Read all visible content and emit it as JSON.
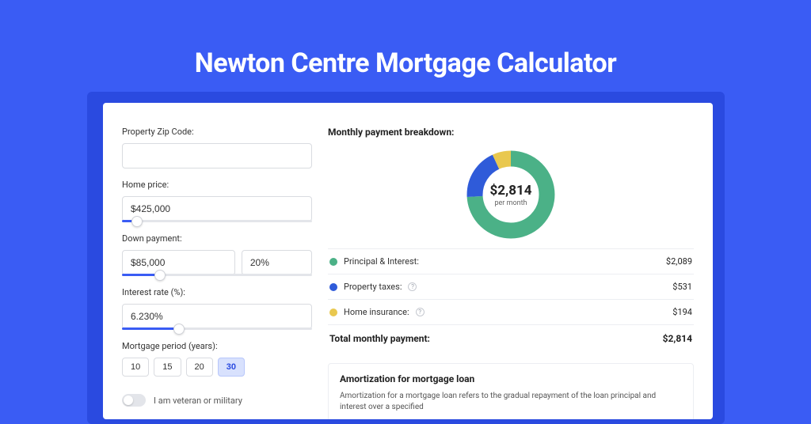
{
  "title": "Newton Centre Mortgage Calculator",
  "form": {
    "zip": {
      "label": "Property Zip Code:",
      "value": ""
    },
    "price": {
      "label": "Home price:",
      "value": "$425,000",
      "slider_pct": 8
    },
    "down": {
      "label": "Down payment:",
      "amount": "$85,000",
      "percent": "20%",
      "slider_pct": 20
    },
    "rate": {
      "label": "Interest rate (%):",
      "value": "6.230%",
      "slider_pct": 30
    },
    "period": {
      "label": "Mortgage period (years):",
      "options": [
        "10",
        "15",
        "20",
        "30"
      ],
      "selected": "30"
    },
    "veteran": {
      "label": "I am veteran or military",
      "value": false
    }
  },
  "breakdown": {
    "heading": "Monthly payment breakdown:",
    "center_amount": "$2,814",
    "center_sub": "per month",
    "items": [
      {
        "color": "green",
        "label": "Principal & Interest:",
        "value": "$2,089",
        "info": false
      },
      {
        "color": "blue",
        "label": "Property taxes:",
        "value": "$531",
        "info": true
      },
      {
        "color": "yellow",
        "label": "Home insurance:",
        "value": "$194",
        "info": true
      }
    ],
    "total_label": "Total monthly payment:",
    "total_value": "$2,814"
  },
  "amort": {
    "title": "Amortization for mortgage loan",
    "text": "Amortization for a mortgage loan refers to the gradual repayment of the loan principal and interest over a specified"
  },
  "chart_data": {
    "type": "pie",
    "title": "Monthly payment breakdown",
    "series": [
      {
        "name": "Principal & Interest",
        "value": 2089,
        "color": "#4bb187"
      },
      {
        "name": "Property taxes",
        "value": 531,
        "color": "#2f5bd9"
      },
      {
        "name": "Home insurance",
        "value": 194,
        "color": "#e9c84f"
      }
    ],
    "total": 2814,
    "center_label": "$2,814 per month"
  }
}
